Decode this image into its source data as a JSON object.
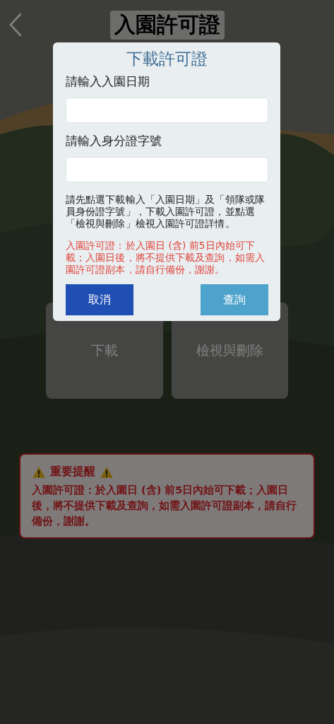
{
  "header": {
    "title": "入園許可證"
  },
  "actions": [
    {
      "label": "下載"
    },
    {
      "label": "檢視與刪除"
    }
  ],
  "notice": {
    "title": "重要提醒",
    "text": "入園許可證：於入園日 (含) 前5日內始可下載；入園日後，將不提供下載及查詢，如需入園許可證副本，請自行備份，謝謝。"
  },
  "dialog": {
    "title": "下載許可證",
    "fields": [
      {
        "label": "請輸入入園日期"
      },
      {
        "label": "請輸入身分證字號"
      }
    ],
    "instructions": "請先點選下載輸入「入園日期」及「領隊或隊員身份證字號」，下載入園許可證，並點選「檢視與刪除」檢視入園許可證詳情。",
    "warning": "入園許可證：於入園日 (含) 前5日內始可下載；入園日後，將不提供下載及查詢，如需入園許可證副本，請自行備份，謝謝。",
    "buttons": [
      {
        "label": "取消",
        "kind": "secondary"
      },
      {
        "label": "查詢",
        "kind": "primary"
      }
    ]
  }
}
